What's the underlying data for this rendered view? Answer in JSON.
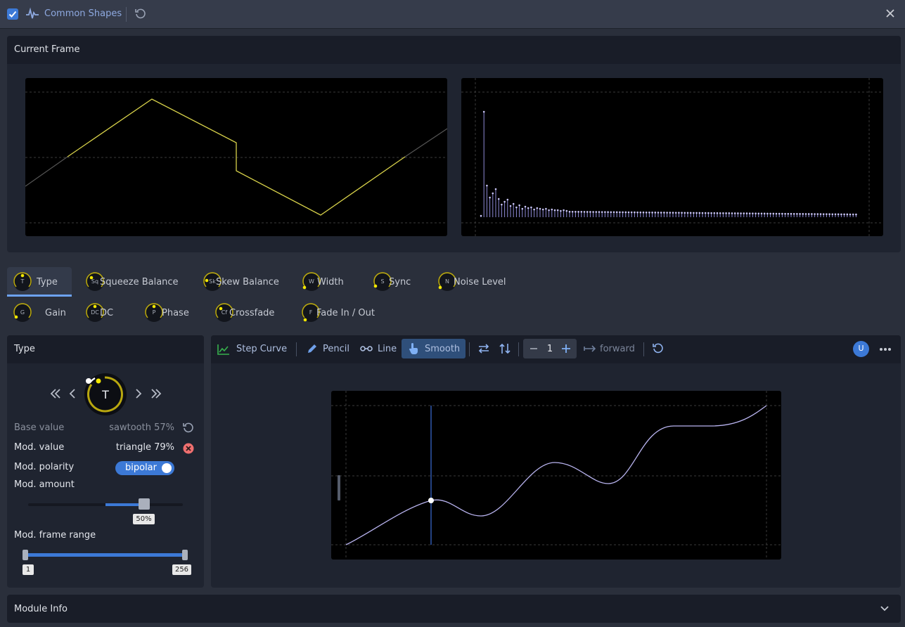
{
  "title_bar": {
    "title": "Common Shapes",
    "checkbox_checked": true
  },
  "current_frame": {
    "title": "Current Frame"
  },
  "parameters_row1": [
    {
      "abbr": "T",
      "label": "Type"
    },
    {
      "abbr": "Sq",
      "label": "Squeeze Balance"
    },
    {
      "abbr": "Sk",
      "label": "Skew Balance"
    },
    {
      "abbr": "W",
      "label": "Width"
    },
    {
      "abbr": "S",
      "label": "Sync"
    },
    {
      "abbr": "N",
      "label": "Noise Level"
    }
  ],
  "parameters_row2": [
    {
      "abbr": "G",
      "label": "Gain"
    },
    {
      "abbr": "DC",
      "label": "DC"
    },
    {
      "abbr": "P",
      "label": "Phase"
    },
    {
      "abbr": "Cf",
      "label": "Crossfade"
    },
    {
      "abbr": "F",
      "label": "Fade In / Out"
    }
  ],
  "type_panel": {
    "title": "Type",
    "knob_letter": "T",
    "base_value_label": "Base value",
    "base_value": "sawtooth 57%",
    "mod_value_label": "Mod. value",
    "mod_value": "triangle 79%",
    "mod_polarity_label": "Mod. polarity",
    "mod_polarity": "bipolar",
    "mod_amount_label": "Mod. amount",
    "mod_amount": "50%",
    "mod_amount_fraction": 0.5,
    "mod_frame_range_label": "Mod. frame range",
    "range_start": "1",
    "range_end": "256"
  },
  "toolbar": {
    "step_curve": "Step Curve",
    "pencil": "Pencil",
    "line": "Line",
    "smooth": "Smooth",
    "stepper_value": "1",
    "direction": "forward",
    "user_badge": "U"
  },
  "module_info": {
    "title": "Module Info"
  },
  "colors": {
    "accent": "#3c79d6",
    "knob_ring": "#b8a70f",
    "waveform": "#d8d24a",
    "curve": "#b9b4f0"
  }
}
